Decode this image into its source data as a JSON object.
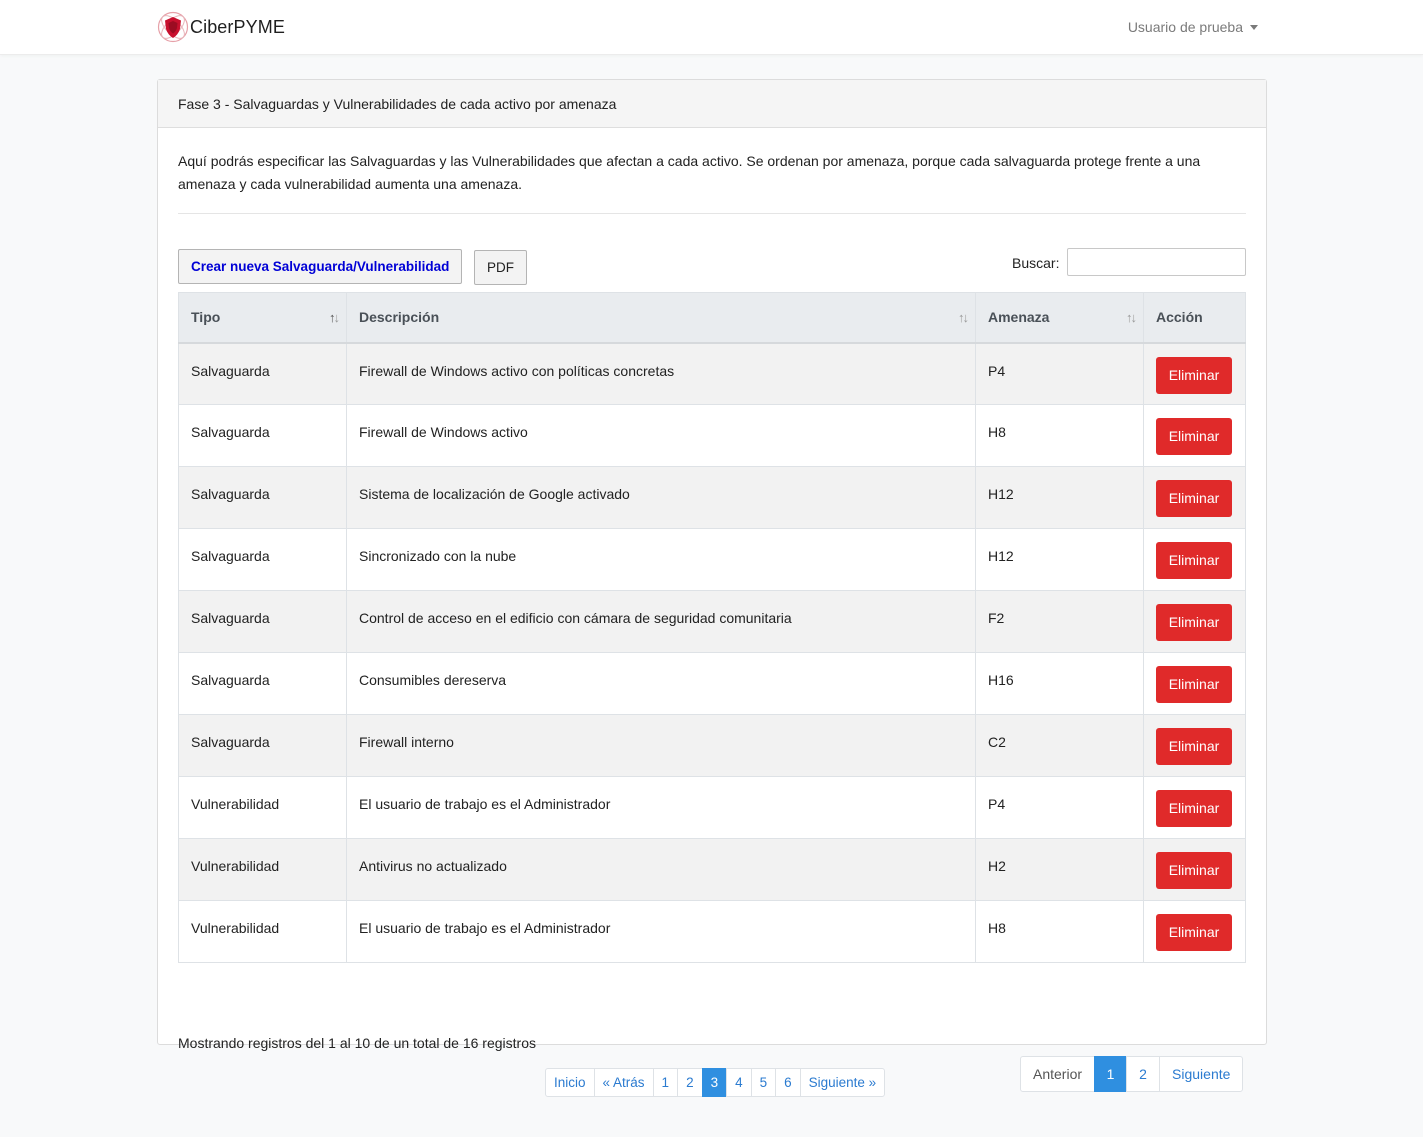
{
  "navbar": {
    "brand": "CiberPYME",
    "user_menu": "Usuario de prueba"
  },
  "card": {
    "title": "Fase 3 - Salvaguardas y Vulnerabilidades de cada activo por amenaza",
    "intro": "Aquí podrás especificar las Salvaguardas y las Vulnerabilidades que afectan a cada activo. Se ordenan por amenaza, porque cada salvaguarda protege frente a una amenaza y cada vulnerabilidad aumenta una amenaza."
  },
  "toolbar": {
    "create_label": "Crear nueva Salvaguarda/Vulnerabilidad",
    "pdf_label": "PDF",
    "search_label": "Buscar:",
    "search_value": ""
  },
  "table": {
    "headers": [
      "Tipo",
      "Descripción",
      "Amenaza",
      "Acción"
    ],
    "rows": [
      {
        "tipo": "Salvaguarda",
        "descripcion": "Firewall de Windows activo con políticas concretas",
        "amenaza": "P4",
        "accion": "Eliminar"
      },
      {
        "tipo": "Salvaguarda",
        "descripcion": "Firewall de Windows activo",
        "amenaza": "H8",
        "accion": "Eliminar"
      },
      {
        "tipo": "Salvaguarda",
        "descripcion": "Sistema de localización de Google activado",
        "amenaza": "H12",
        "accion": "Eliminar"
      },
      {
        "tipo": "Salvaguarda",
        "descripcion": "Sincronizado con la nube",
        "amenaza": "H12",
        "accion": "Eliminar"
      },
      {
        "tipo": "Salvaguarda",
        "descripcion": "Control de acceso en el edificio con cámara de seguridad comunitaria",
        "amenaza": "F2",
        "accion": "Eliminar"
      },
      {
        "tipo": "Salvaguarda",
        "descripcion": "Consumibles dereserva",
        "amenaza": "H16",
        "accion": "Eliminar"
      },
      {
        "tipo": "Salvaguarda",
        "descripcion": "Firewall interno",
        "amenaza": "C2",
        "accion": "Eliminar"
      },
      {
        "tipo": "Vulnerabilidad",
        "descripcion": "El usuario de trabajo es el Administrador",
        "amenaza": "P4",
        "accion": "Eliminar"
      },
      {
        "tipo": "Vulnerabilidad",
        "descripcion": "Antivirus no actualizado",
        "amenaza": "H2",
        "accion": "Eliminar"
      },
      {
        "tipo": "Vulnerabilidad",
        "descripcion": "El usuario de trabajo es el Administrador",
        "amenaza": "H8",
        "accion": "Eliminar"
      }
    ],
    "info": "Mostrando registros del 1 al 10 de un total de 16 registros"
  },
  "table_pager": {
    "prev": "Anterior",
    "pages": [
      "1",
      "2"
    ],
    "active": "1",
    "next": "Siguiente"
  },
  "phase_pager": {
    "items": [
      "Inicio",
      "« Atrás",
      "1",
      "2",
      "3",
      "4",
      "5",
      "6",
      "Siguiente »"
    ],
    "active": "3"
  },
  "colors": {
    "accent": "#2f8fe0",
    "danger": "#e02a2a",
    "brand_red": "#c8102e"
  },
  "icons": {
    "brand": "shield-logo-icon",
    "sort": "sort-arrows-icon",
    "user_menu": "caret-down-icon"
  }
}
